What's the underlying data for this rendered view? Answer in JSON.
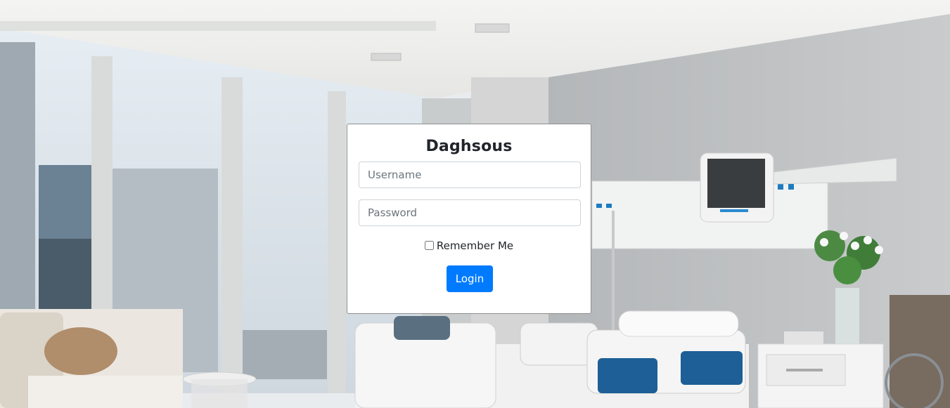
{
  "login": {
    "title": "Daghsous",
    "username_placeholder": "Username",
    "password_placeholder": "Password",
    "remember_label": "Remember Me",
    "submit_label": "Login"
  },
  "colors": {
    "primary_button": "#007bff",
    "card_background": "#ffffff"
  }
}
